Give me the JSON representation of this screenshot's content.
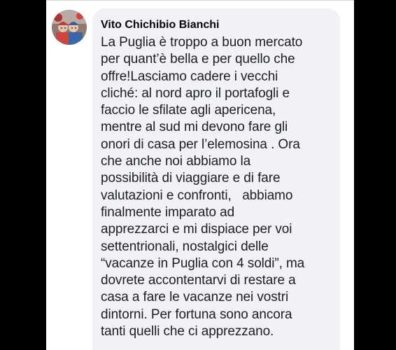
{
  "comment": {
    "author": "Vito Chichibio Bianchi",
    "lines": [
      "La Puglia è troppo a buon mercato",
      "per quant’è bella e per quello che",
      "offre!Lasciamo cadere i vecchi",
      "cliché: al nord apro il portafogli e",
      "faccio le sfilate agli apericena,",
      "mentre al sud mi devono fare gli",
      "onori di casa per l’elemosina . Ora",
      "che anche noi abbiamo la",
      "possibilità di viaggiare e di fare",
      "valutazioni e confronti,   abbiamo",
      "finalmente imparato ad",
      "apprezzarci e mi dispiace per voi",
      "settentrionali, nostalgici delle",
      "“vacanze in Puglia con 4 soldi”, ma",
      "dovrete accontentarvi di restare a",
      "casa a fare le vacanze nei vostri",
      "dintorni. Per fortuna sono ancora",
      "tanti quelli che ci apprezzano."
    ]
  },
  "colors": {
    "page_background": "#ffffff",
    "outer_background": "#000000",
    "bubble_background": "#f0f2f5",
    "author_text": "#050505",
    "comment_text": "#1c1e21"
  }
}
